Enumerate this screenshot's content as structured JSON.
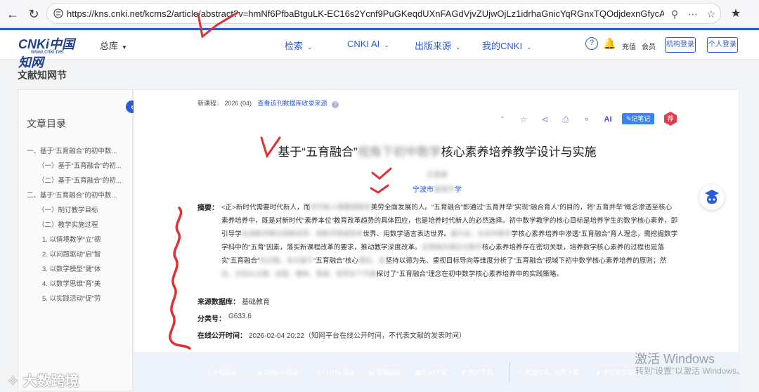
{
  "browser": {
    "url": "https://kns.cnki.net/kcms2/article/abstract?v=hmNf6PfbaBtguLK-EC16s2Ycnf9PuGKeqdUXnFAGdVjvZUjwOjLz1idrhaGnicYqRGnxTQOdjdexnGfycAAOnD0uC...",
    "back_icon": "arrow-left-icon",
    "reload_icon": "reload-icon"
  },
  "header": {
    "logo_text": "CNKi中国知网",
    "logo_sub": "www.cnki.net",
    "all_label": "总库",
    "nav": [
      "检索",
      "CNKI AI",
      "出版来源",
      "我的CNKI"
    ],
    "recharge": "充值",
    "member": "会员",
    "org_login": "机构登录",
    "personal_login": "个人登录"
  },
  "section_title": "文献知网节",
  "toc": {
    "title": "文章目录",
    "items": [
      "一、基于“五育融合”的初中数...",
      "（一）基于“五育融合”的初...",
      "（二）基于“五育融合”的初...",
      "二、基于“五育融合”的初中数...",
      "（一）制订教学目标",
      "（二）教学实施过程",
      "1. 以情境教学“立”德",
      "2. 以问题驱动“启”智",
      "3. 以数学模型“健”体",
      "4. 以数学思维“育”美",
      "5. 以实践活动“促”劳"
    ]
  },
  "article": {
    "meta_source": "新课程． 2026 (04)",
    "meta_link": "查看该刊数据库收录来源",
    "title_start": "基于“五育融合”",
    "title_hidden": "视角下初中数学",
    "title_end": "核心素养培养教学设计与实施",
    "author": "王某某",
    "affiliation_start": "宁波市",
    "affiliation_hidden": "某某中",
    "affiliation_end": "学",
    "note_button": "记笔记",
    "badge": "荐",
    "abstract_label": "摘要：",
    "abstract": [
      {
        "t": "<正>新时代需要时代新人，而",
        "b": false
      },
      {
        "t": "时代新人需要德智体",
        "b": true
      },
      {
        "t": "美劳全面发展的人。“五育融合”即通过“五育并举”实现“融合育人”的目的，将“五育并举”概念渗透至核心素养培养中，既是对新时代“素养本位”教育改革趋势的具体回应，也是培养时代新人的必然选择。初中数学教学的核心目标是培养学生的数学核心素养，即引导学",
        "b": false
      },
      {
        "t": "生用数学眼光观察世界、用数学思维思考",
        "b": true
      },
      {
        "t": "世界、用数学语言表达世界。",
        "b": false
      },
      {
        "t": "基于此，在初中数学",
        "b": true
      },
      {
        "t": "学核心素养培养中渗透“五育融合”育人理念，需挖掘数学学科中的“五育”因素，落实新课程改革的要求，推动教学深度改革。",
        "b": false
      },
      {
        "t": "五育融合理念与数学",
        "b": true
      },
      {
        "t": "核心素养培养存在密切关联，培养数学核心素养的过程也是落实“五育融合”",
        "b": false
      },
      {
        "t": "的过程。本文基于",
        "b": true
      },
      {
        "t": "“五育融合”核心",
        "b": false
      },
      {
        "t": "理念，坚",
        "b": true
      },
      {
        "t": "坚持以德为先、重视目标导向等维度分析了“五育融合”视域下初中数学核心素养培养的原则；然",
        "b": false
      },
      {
        "t": "后，分别从立德、启智、健体、育美、促劳五个方面",
        "b": true
      },
      {
        "t": "探讨了“五育融合”理念在初中数学核心素养培养中的实践策略。",
        "b": false
      }
    ],
    "db_label": "来源数据库：",
    "db_value": "基础教育",
    "class_label": "分类号：",
    "class_value": "G633.6",
    "online_label": "在线公开时间：",
    "online_value": "2026-02-04 20:22（知网平台在线公开时间，不代表文献的发表时间）"
  },
  "buttons": [
    {
      "label": "手机阅读",
      "icon": "phone-icon",
      "color": "#29b6c8"
    },
    {
      "label": "CNKI AI阅读",
      "icon": "ai-icon",
      "color": "#8a63d2"
    },
    {
      "label": "HTML阅读",
      "icon": "code-icon",
      "color": "#f0852d"
    },
    {
      "label": "原版阅读",
      "icon": "book-icon",
      "color": "#6a5acd"
    },
    {
      "label": "CAJ下载",
      "icon": "caj-icon",
      "color": "#3b6fd6"
    },
    {
      "label": "PDF下载",
      "icon": "pdf-icon",
      "color": "#5cb85c"
    },
    {
      "label": "我是作者，免费下载",
      "icon": "download-icon",
      "color": "#3b6fd6"
    },
    {
      "label": "学位论文投稿",
      "icon": "cap-icon",
      "color": "#3b6fd6"
    }
  ],
  "os": {
    "activate_title": "激活 Windows",
    "activate_sub": "转到“设置”以激活 Windows。",
    "watermark": "大数跨境"
  },
  "colors": {
    "brand": "#2a5bd7",
    "annotation": "#e03030"
  }
}
